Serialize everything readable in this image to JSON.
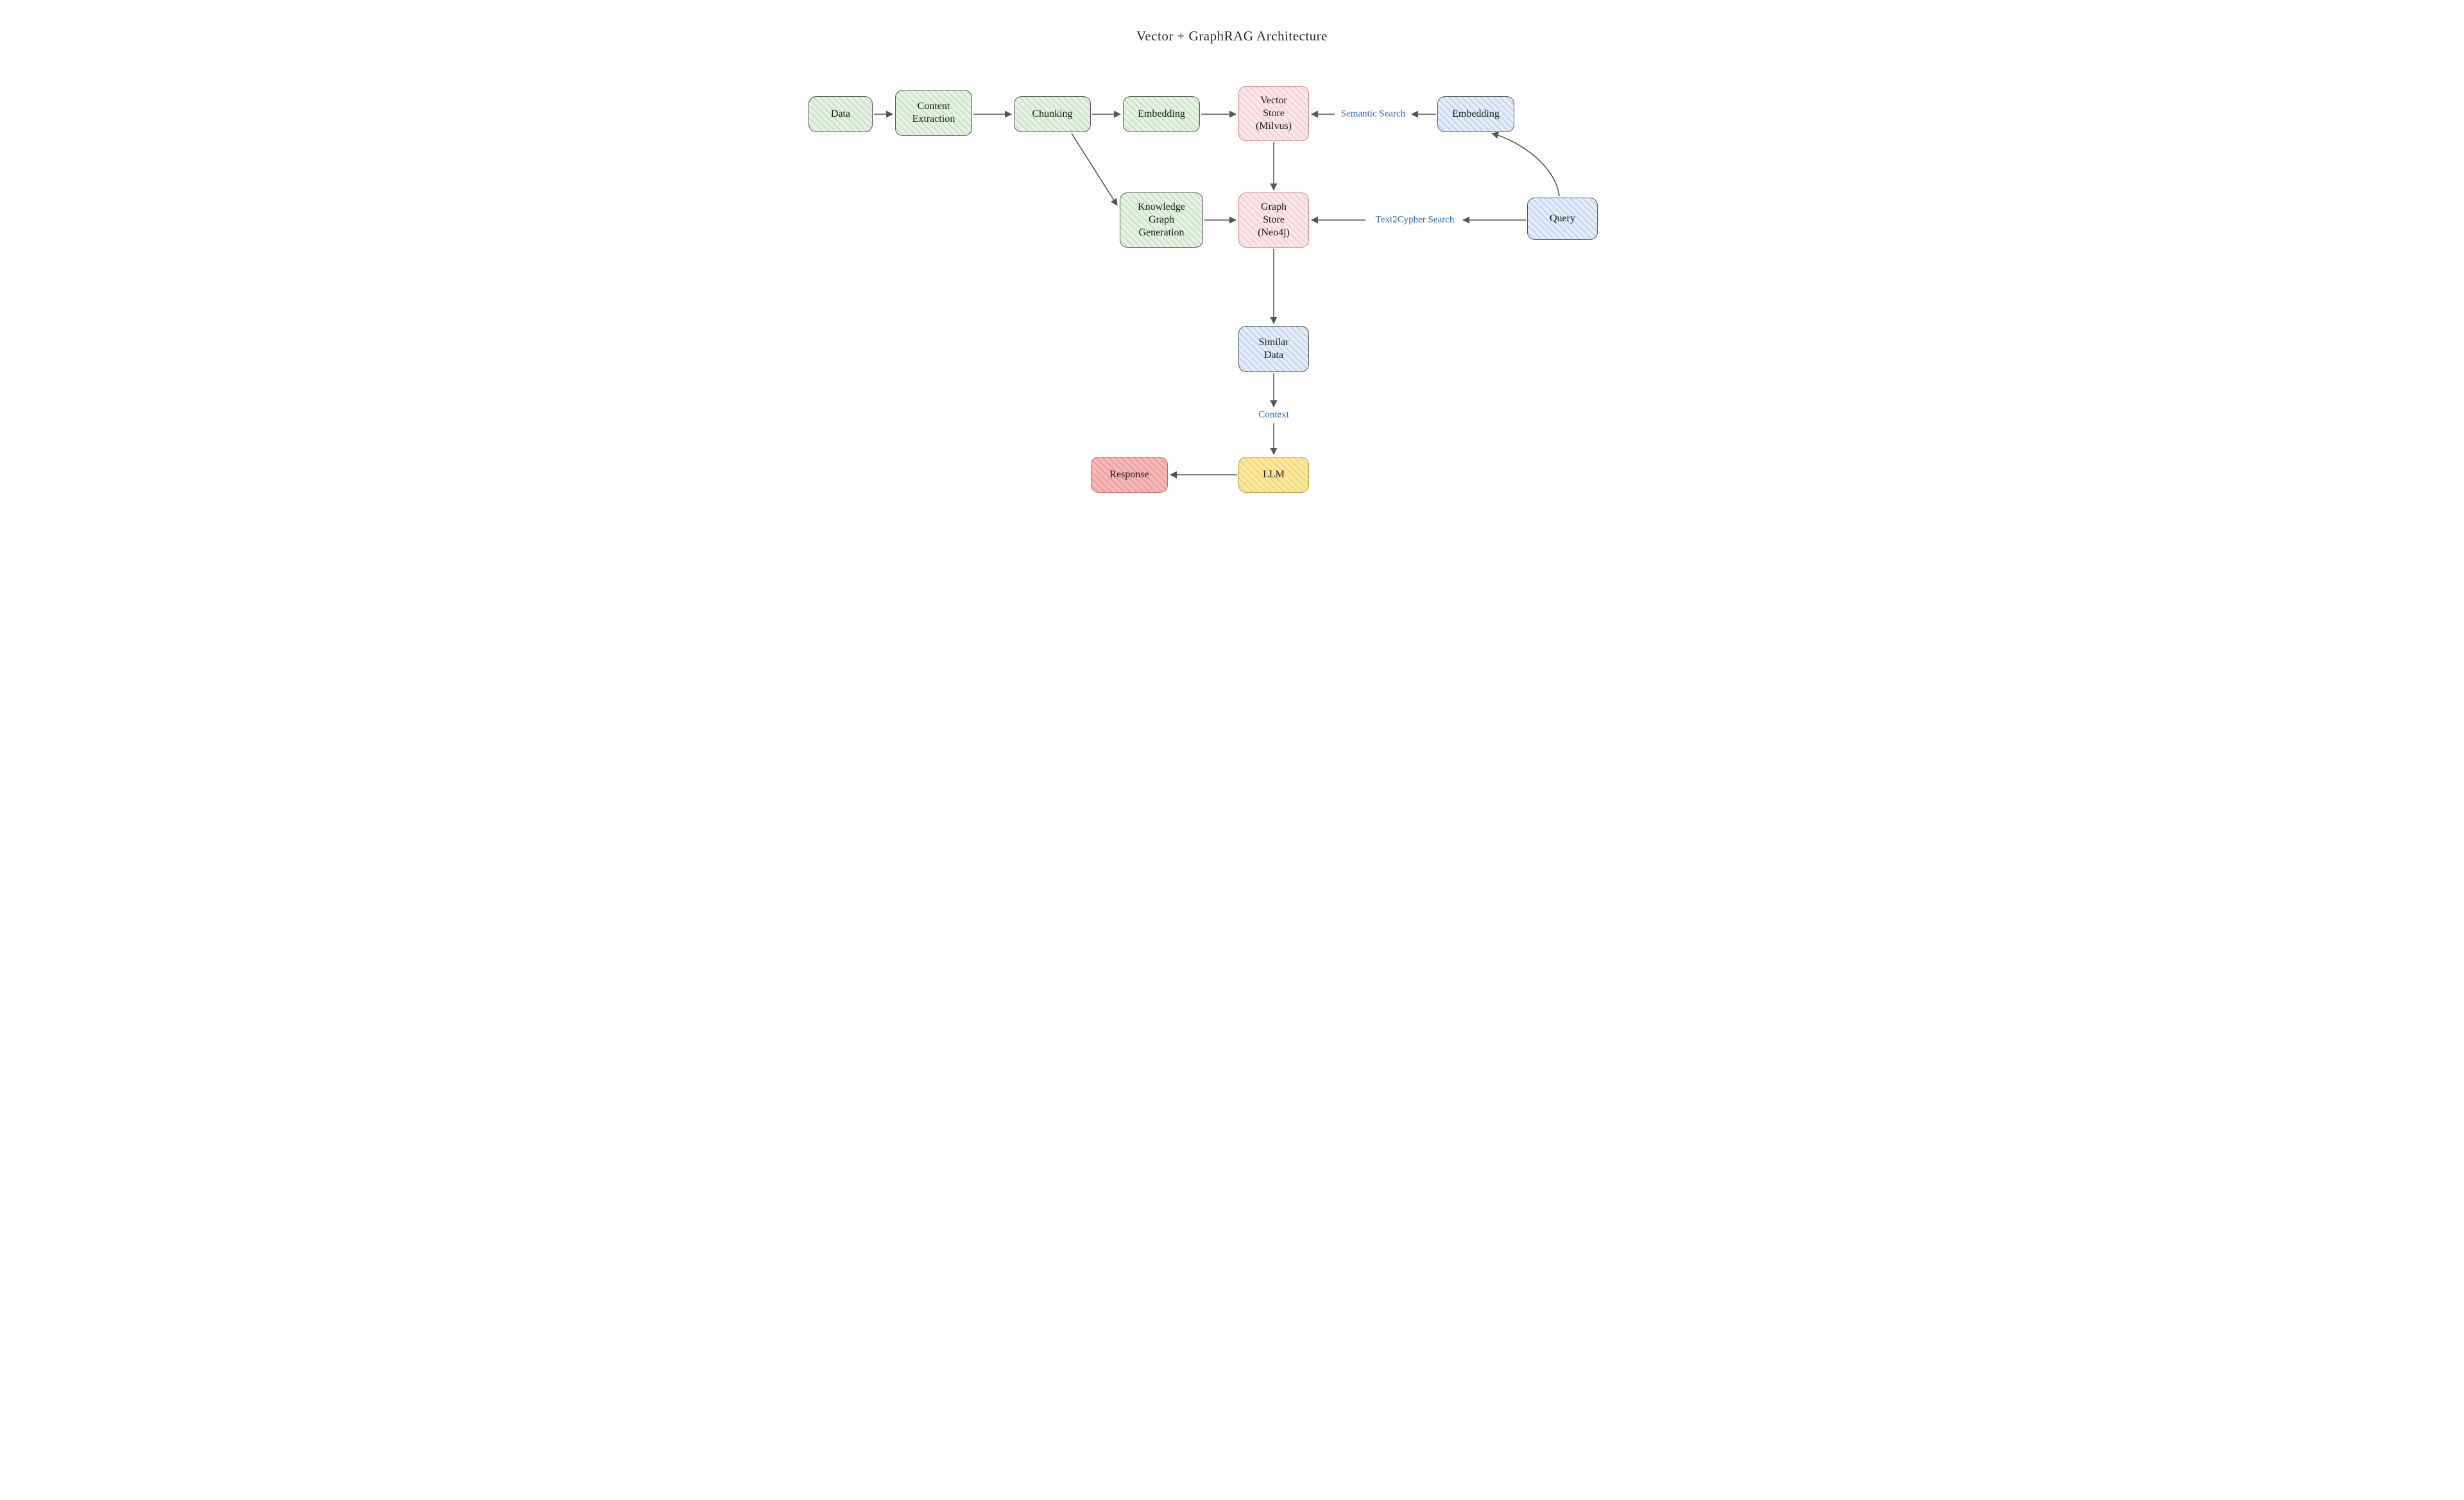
{
  "title": "Vector + GraphRAG Architecture",
  "nodes": {
    "data": {
      "label": "Data"
    },
    "content_extract": {
      "label": "Content\nExtraction"
    },
    "chunking": {
      "label": "Chunking"
    },
    "embedding_left": {
      "label": "Embedding"
    },
    "vector_store": {
      "label": "Vector\nStore\n(Milvus)"
    },
    "kg_gen": {
      "label": "Knowledge\nGraph\nGeneration"
    },
    "graph_store": {
      "label": "Graph\nStore\n(Neo4j)"
    },
    "embedding_right": {
      "label": "Embedding"
    },
    "query": {
      "label": "Query"
    },
    "similar_data": {
      "label": "Similar\nData"
    },
    "llm": {
      "label": "LLM"
    },
    "response": {
      "label": "Response"
    }
  },
  "edges": {
    "semantic_search": {
      "label": "Semantic Search"
    },
    "text2cypher_search": {
      "label": "Text2Cypher Search"
    },
    "context": {
      "label": "Context"
    }
  }
}
